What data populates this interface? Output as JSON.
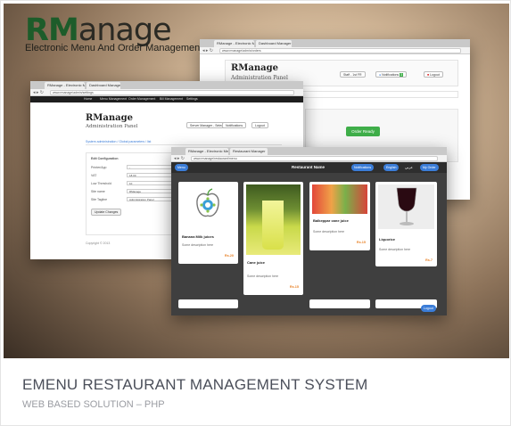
{
  "logo": {
    "brand": "RManage",
    "brand_prefix": "RM",
    "brand_rest": "anage",
    "tagline": "Electronic Menu And Order Management"
  },
  "window_orders": {
    "tabs": [
      "RManage - Electronic Menu &...",
      "Dashboard Manager"
    ],
    "url": "www.rmanage/admin/orders",
    "heading": "RManage",
    "subheading": "Administration Panel",
    "select_value": "Staff - 1st FR",
    "buttons": [
      "Notifications",
      "Logout"
    ],
    "order_ready_label": "Order Ready"
  },
  "window_settings": {
    "tabs": [
      "RManage - Electronic Menu &...",
      "Dashboard Manager"
    ],
    "url": "www.rmanage/admin/settings",
    "nav_items": [
      "Home",
      "Menu Management",
      "Order Management",
      "Bill Management",
      "Settings"
    ],
    "heading": "RManage",
    "subheading": "Administration Panel",
    "select_value": "Server Manager - Select",
    "buttons": [
      "Notifications",
      "Logout"
    ],
    "breadcrumb": "System administration  /  Global parameters  /  list",
    "form_title": "Edit Configuration",
    "fields": [
      {
        "label": "Printer/App",
        "value": "-"
      },
      {
        "label": "VAT",
        "value": "18.00"
      },
      {
        "label": "Low Threshold",
        "value": "10"
      },
      {
        "label": "Site name",
        "value": "RManage"
      },
      {
        "label": "Site Tagline",
        "value": "Administration Panel"
      }
    ],
    "submit_label": "Update Changes",
    "footer": "Copyright © 2013"
  },
  "window_menu": {
    "tabs": [
      "RManage - Electronic Menu &...",
      "Restaurant Manager"
    ],
    "url": "www.rmanage/restaurant/menu",
    "back_label": "Menu",
    "title": "Restaurant Name",
    "notification_label": "Notifications",
    "language_label": "English",
    "language_alt": "عربي",
    "order_label": "My Order",
    "items": [
      {
        "name": "Banana Milk juices",
        "desc": "Some description here",
        "price": "Rs.20"
      },
      {
        "name": "Cane juice",
        "desc": "Some description here",
        "price": "Rs.15"
      },
      {
        "name": "Balkeppar cane juice",
        "desc": "Some description here",
        "price": "Rs.15"
      },
      {
        "name": "Liquorice",
        "desc": "Some description here",
        "price": "Rs.7"
      }
    ],
    "logout_label": "Logout"
  },
  "caption": {
    "title": "EMENU RESTAURANT MANAGEMENT SYSTEM",
    "subtitle": "WEB BASED SOLUTION – PHP"
  },
  "colors": {
    "brand_green": "#1d5c2a",
    "price_orange": "#e8832a",
    "button_blue": "#3b7dd8",
    "order_ready_green": "#3fae49",
    "caption_text": "#4b4f5a"
  },
  "icons": [
    "traffic-light-icon",
    "back-icon",
    "forward-icon",
    "refresh-icon",
    "home-icon",
    "apple-gear-icon"
  ]
}
